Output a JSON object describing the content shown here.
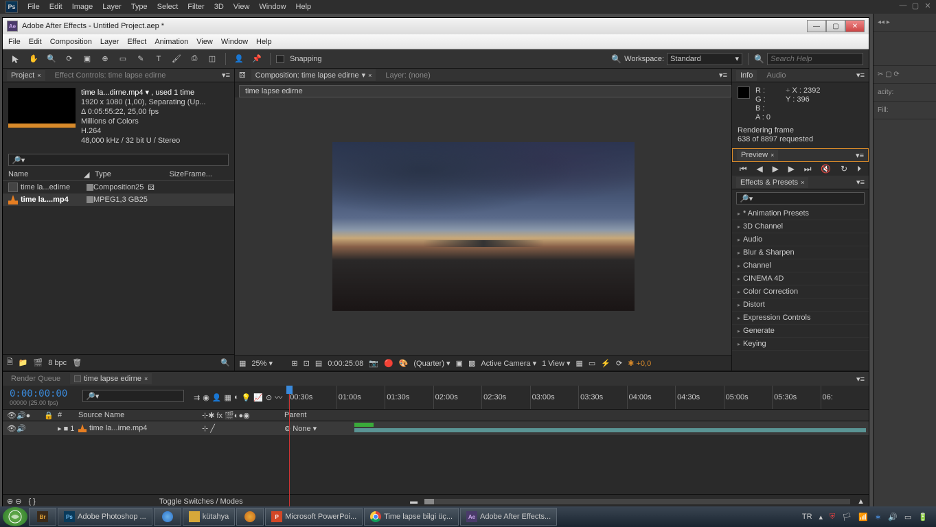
{
  "photoshop": {
    "menus": [
      "File",
      "Edit",
      "Image",
      "Layer",
      "Type",
      "Select",
      "Filter",
      "3D",
      "View",
      "Window",
      "Help"
    ],
    "side_labels": [
      "",
      "",
      "",
      "",
      "acity:",
      "",
      "Fill:",
      ""
    ]
  },
  "ae": {
    "title": "Adobe After Effects - Untitled Project.aep *",
    "menus": [
      "File",
      "Edit",
      "Composition",
      "Layer",
      "Effect",
      "Animation",
      "View",
      "Window",
      "Help"
    ],
    "toolbar": {
      "snapping": "Snapping",
      "workspace_label": "Workspace:",
      "workspace_value": "Standard",
      "search_placeholder": "Search Help"
    },
    "project": {
      "tab_project": "Project",
      "tab_effectcontrols": "Effect Controls: time lapse edirne",
      "asset_name": "time la...dirne.mp4 ▾ , used 1 time",
      "asset_dims": "1920 x 1080 (1,00), Separating (Up...",
      "asset_dur": "Δ 0:05:55:22, 25,00 fps",
      "asset_colors": "Millions of Colors",
      "asset_codec": "H.264",
      "asset_audio": "48,000 kHz / 32 bit U / Stereo",
      "cols": {
        "name": "Name",
        "type": "Type",
        "size": "Size",
        "frame": "Frame..."
      },
      "rows": [
        {
          "name": "time la...edirne",
          "type": "Composition",
          "size": "",
          "fps": "25"
        },
        {
          "name": "time la....mp4",
          "type": "MPEG",
          "size": "1,3 GB",
          "fps": "25"
        }
      ],
      "bpc": "8 bpc"
    },
    "composition": {
      "tab": "Composition: time lapse edirne",
      "layer_tab": "Layer: (none)",
      "subtab": "time lapse edirne",
      "zoom": "25%",
      "timecode": "0:00:25:08",
      "res": "(Quarter)",
      "camera": "Active Camera",
      "view": "1 View"
    },
    "info": {
      "tab_info": "Info",
      "tab_audio": "Audio",
      "r": "R :",
      "g": "G :",
      "b": "B :",
      "a": "A : 0",
      "x": "X : 2392",
      "y": "Y : 396",
      "rendering": "Rendering frame",
      "progress": "638 of 8897 requested"
    },
    "preview": {
      "tab": "Preview"
    },
    "effects": {
      "tab": "Effects & Presets",
      "items": [
        "* Animation Presets",
        "3D Channel",
        "Audio",
        "Blur & Sharpen",
        "Channel",
        "CINEMA 4D",
        "Color Correction",
        "Distort",
        "Expression Controls",
        "Generate",
        "Keying"
      ]
    },
    "timeline": {
      "tab_render": "Render Queue",
      "tab_comp": "time lapse edirne",
      "timecode": "0:00:00:00",
      "fps": "00000 (25.00 fps)",
      "ticks": [
        "00:30s",
        "01:00s",
        "01:30s",
        "02:00s",
        "02:30s",
        "03:00s",
        "03:30s",
        "04:00s",
        "04:30s",
        "05:00s",
        "05:30s",
        "06:"
      ],
      "col_source": "Source Name",
      "col_parent": "Parent",
      "layer_num": "1",
      "layer_name": "time la...irne.mp4",
      "layer_parent": "None",
      "toggle": "Toggle Switches / Modes"
    }
  },
  "taskbar": {
    "items": [
      {
        "label": "Adobe Photoshop ...",
        "icon": "ps"
      },
      {
        "label": "",
        "icon": "ie"
      },
      {
        "label": "kütahya",
        "icon": "folder"
      },
      {
        "label": "",
        "icon": "wmp"
      },
      {
        "label": "Microsoft PowerPoi...",
        "icon": "ppt"
      },
      {
        "label": "Time lapse bilgi üç...",
        "icon": "chrome"
      },
      {
        "label": "Adobe After Effects...",
        "icon": "ae"
      }
    ],
    "lang": "TR",
    "time": "",
    "br_icon": "Br"
  }
}
